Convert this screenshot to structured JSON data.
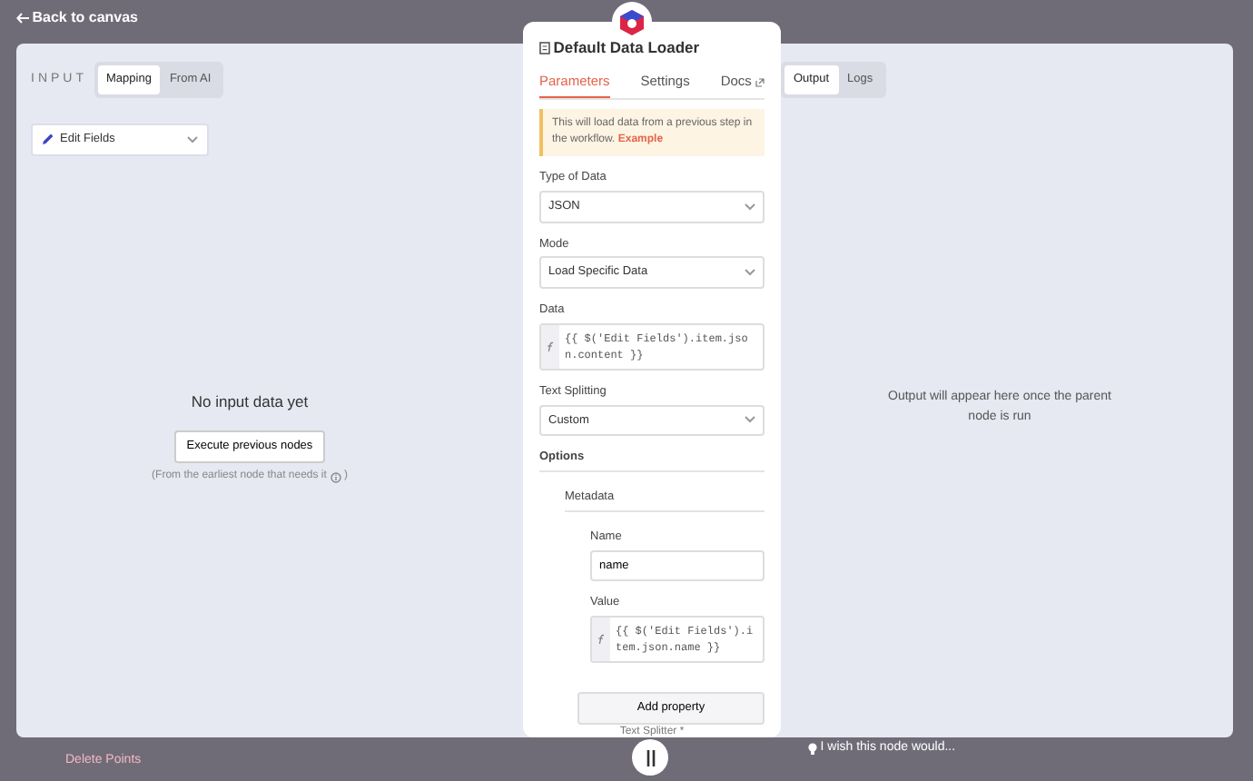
{
  "header": {
    "back_link": "Back to canvas"
  },
  "input_panel": {
    "title": "INPUT",
    "tabs": [
      {
        "label": "Mapping",
        "selected": true
      },
      {
        "label": "From AI",
        "selected": false
      }
    ],
    "node_select": "Edit Fields",
    "empty_title": "No input data yet",
    "execute_button": "Execute previous nodes",
    "hint": "(From the earliest node that needs it",
    "hint_end": ")"
  },
  "node": {
    "title": "Default Data Loader",
    "tabs": [
      {
        "label": "Parameters",
        "selected": true
      },
      {
        "label": "Settings",
        "selected": false
      },
      {
        "label": "Docs",
        "selected": false
      }
    ],
    "notice": "This will load data from a previous step in the workflow. ",
    "notice_link": "Example",
    "fields": [
      {
        "kind": "select",
        "label": "Type of Data",
        "value": "JSON"
      },
      {
        "kind": "select",
        "label": "Mode",
        "value": "Load Specific Data"
      },
      {
        "kind": "expression",
        "label": "Data",
        "value": "{{ $('Edit Fields').item.json.content }}"
      },
      {
        "kind": "select",
        "label": "Text Splitting",
        "value": "Custom"
      }
    ],
    "options_label": "Options",
    "metadata_label": "Metadata",
    "metadata_fields": [
      {
        "kind": "text",
        "label": "Name",
        "value": "name"
      },
      {
        "kind": "expression",
        "label": "Value",
        "value": "{{ $('Edit Fields').item.json.name }}"
      }
    ],
    "add_button": "Add property",
    "footer": "Text Splitter *"
  },
  "output_panel": {
    "tabs": [
      {
        "label": "Output",
        "selected": true
      },
      {
        "label": "Logs",
        "selected": false
      }
    ],
    "message": "Output will appear here once the parent node is run"
  },
  "canvas": {
    "left_item": "Delete Points",
    "right_item": "I wish this node would..."
  }
}
